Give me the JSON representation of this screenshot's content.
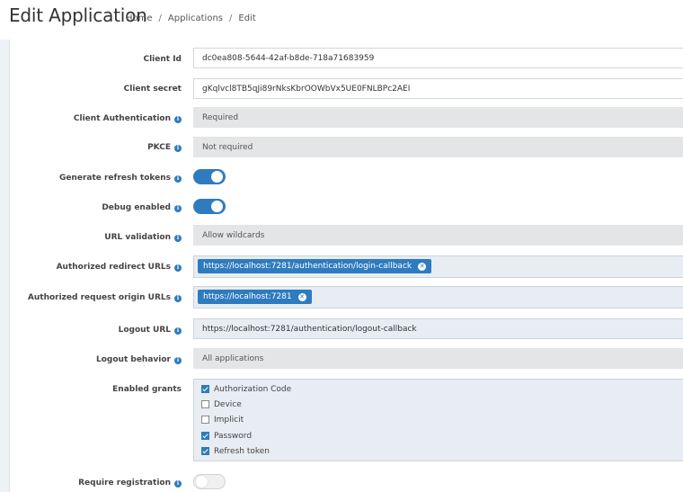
{
  "header": {
    "title": "Edit Application",
    "breadcrumb": [
      {
        "label": "Home"
      },
      {
        "label": "Applications"
      },
      {
        "label": "Edit"
      }
    ],
    "separator": "/"
  },
  "form": {
    "client_id": {
      "label": "Client Id",
      "value": "dc0ea808-5644-42af-b8de-718a71683959"
    },
    "client_secret": {
      "label": "Client secret",
      "value": "gKqlvcl8TB5qJi89rNksKbrOOWbVx5UE0FNLBPc2AEI"
    },
    "client_authentication": {
      "label": "Client Authentication",
      "value": "Required"
    },
    "pkce": {
      "label": "PKCE",
      "value": "Not required"
    },
    "generate_refresh_tokens": {
      "label": "Generate refresh tokens",
      "enabled": true
    },
    "debug_enabled": {
      "label": "Debug enabled",
      "enabled": true
    },
    "url_validation": {
      "label": "URL validation",
      "value": "Allow wildcards"
    },
    "authorized_redirect_urls": {
      "label": "Authorized redirect URLs",
      "chips": [
        "https://localhost:7281/authentication/login-callback"
      ]
    },
    "authorized_request_origin_urls": {
      "label": "Authorized request origin URLs",
      "chips": [
        "https://localhost:7281"
      ]
    },
    "logout_url": {
      "label": "Logout URL",
      "value": "https://localhost:7281/authentication/logout-callback"
    },
    "logout_behavior": {
      "label": "Logout behavior",
      "value": "All applications"
    },
    "enabled_grants": {
      "label": "Enabled grants",
      "options": [
        {
          "label": "Authorization Code",
          "checked": true
        },
        {
          "label": "Device",
          "checked": false
        },
        {
          "label": "Implicit",
          "checked": false
        },
        {
          "label": "Password",
          "checked": true
        },
        {
          "label": "Refresh token",
          "checked": true
        }
      ]
    },
    "require_registration": {
      "label": "Require registration",
      "enabled": false
    }
  },
  "icons": {
    "info": "info-icon",
    "chip_remove": "close-circle-icon"
  },
  "colors": {
    "accent": "#2f7bbf",
    "readonly_bg": "#e4e5e7",
    "chip_field_bg": "#e8edf3"
  }
}
